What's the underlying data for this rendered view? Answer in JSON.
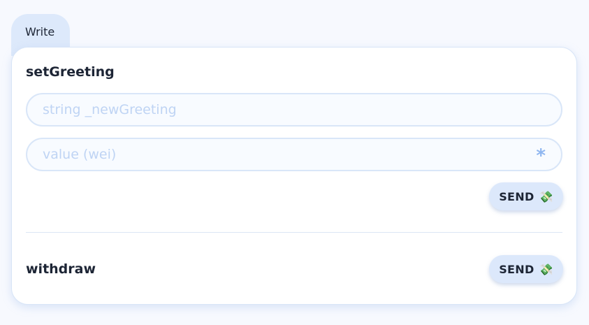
{
  "tab": {
    "label": "Write"
  },
  "functions": {
    "setGreeting": {
      "title": "setGreeting",
      "arg_placeholder": "string _newGreeting",
      "value_placeholder": "value (wei)",
      "value_symbol": "*",
      "send_label": "SEND",
      "send_icon": "💸"
    },
    "withdraw": {
      "title": "withdraw",
      "send_label": "SEND",
      "send_icon": "💸"
    }
  }
}
